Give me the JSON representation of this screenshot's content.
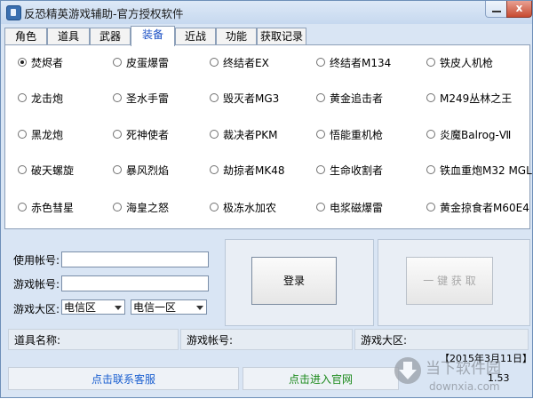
{
  "window": {
    "title": "反恐精英游戏辅助-官方授权软件",
    "close_glyph": "x"
  },
  "tabs": [
    {
      "label": "角色"
    },
    {
      "label": "道具"
    },
    {
      "label": "武器"
    },
    {
      "label": "装备",
      "active": true
    },
    {
      "label": "近战"
    },
    {
      "label": "功能"
    },
    {
      "label": "获取记录"
    }
  ],
  "equipment": [
    [
      "焚烬者",
      "皮蛋爆雷",
      "终结者EX",
      "终结者M134",
      "铁皮人机枪"
    ],
    [
      "龙击炮",
      "圣水手雷",
      "毁灭者MG3",
      "黄金追击者",
      "M249丛林之王"
    ],
    [
      "黑龙炮",
      "死神使者",
      "裁决者PKM",
      "悟能重机枪",
      "炎魔Balrog-Ⅶ"
    ],
    [
      "破天螺旋",
      "暴风烈焰",
      "劫掠者MK48",
      "生命收割者",
      "铁血重炮M32 MGL"
    ],
    [
      "赤色彗星",
      "海皇之怒",
      "极冻水加农",
      "电浆磁爆雷",
      "黄金掠食者M60E4"
    ]
  ],
  "selected_equipment": "焚烬者",
  "login": {
    "use_account_label": "使用帐号:",
    "use_account_value": "",
    "game_account_label": "游戏帐号:",
    "game_account_value": "",
    "region_label": "游戏大区:",
    "region_isp": "电信区",
    "region_server": "电信一区",
    "login_button": "登录",
    "one_click_button": "一 键 获 取"
  },
  "status": {
    "item_name_label": "道具名称:",
    "game_account_label": "游戏帐号:",
    "region_label": "游戏大区:"
  },
  "footer": {
    "contact_button": "点击联系客服",
    "website_button": "点击进入官网",
    "date": "【2015年3月11日】",
    "version": "1.53"
  },
  "watermark": {
    "text_cn": "当下软件园",
    "text_en": "downxia.com"
  },
  "colors": {
    "accent": "#1a4fc4",
    "link": "#1a5fd0",
    "website": "#1c8a1c"
  }
}
